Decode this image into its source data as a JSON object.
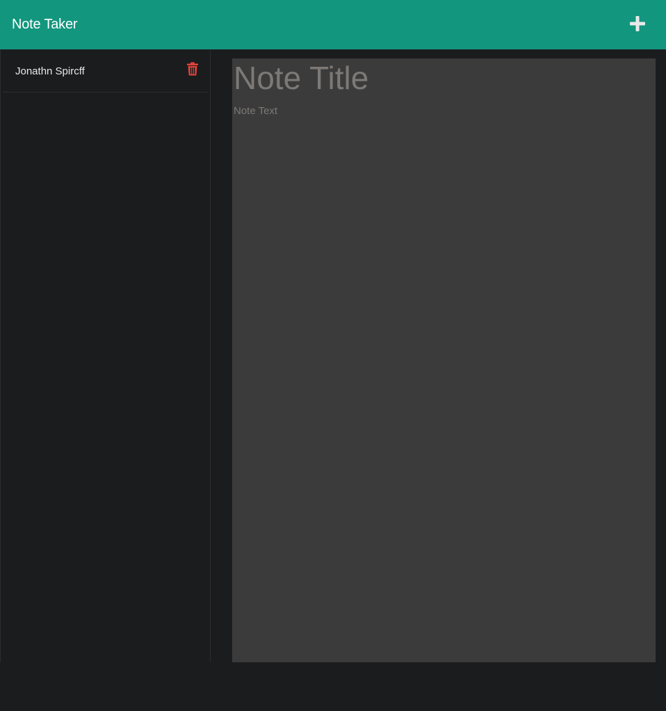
{
  "navbar": {
    "brand": "Note Taker",
    "new_note_icon": "plus-icon",
    "background_color": "#13967e"
  },
  "sidebar": {
    "notes": [
      {
        "title": "Jonathn Spircff",
        "delete_icon": "trash-icon"
      }
    ]
  },
  "editor": {
    "title_placeholder": "Note Title",
    "text_placeholder": "Note Text",
    "title_value": "",
    "text_value": ""
  },
  "colors": {
    "accent": "#13967e",
    "delete": "#e5423a",
    "background": "#1b1c1e",
    "editor_bg": "#3b3b3b"
  }
}
